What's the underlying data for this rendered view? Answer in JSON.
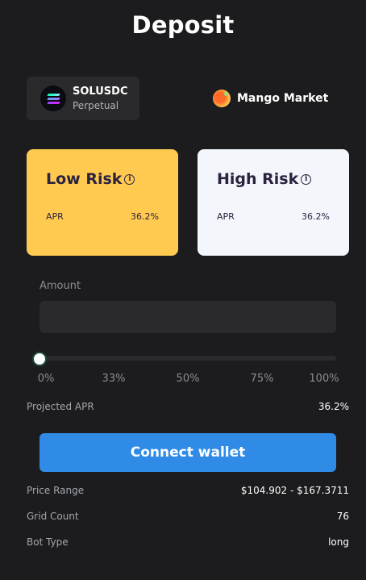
{
  "header": {
    "title": "Deposit"
  },
  "market": {
    "symbol": "SOLUSDC",
    "type": "Perpetual",
    "icon": "solana-icon"
  },
  "exchange": {
    "name": "Mango Market",
    "icon": "mango-icon"
  },
  "risk_options": [
    {
      "title": "Low Risk",
      "apr_label": "APR",
      "apr_value": "36.2%",
      "selected": true,
      "color": "#ffca4f"
    },
    {
      "title": "High Risk",
      "apr_label": "APR",
      "apr_value": "36.2%",
      "selected": false,
      "color": "#f3f6fb"
    }
  ],
  "amount": {
    "label": "Amount",
    "value": "",
    "placeholder": ""
  },
  "slider": {
    "value_percent": 0,
    "ticks": [
      "0%",
      "33%",
      "50%",
      "75%",
      "100%"
    ]
  },
  "projected_apr": {
    "label": "Projected APR",
    "value": "36.2%"
  },
  "connect_button": {
    "label": "Connect wallet",
    "color": "#2f8be6"
  },
  "details": [
    {
      "label": "Price Range",
      "value": "$104.902 - $167.3711"
    },
    {
      "label": "Grid Count",
      "value": "76"
    },
    {
      "label": "Bot Type",
      "value": "long"
    }
  ]
}
